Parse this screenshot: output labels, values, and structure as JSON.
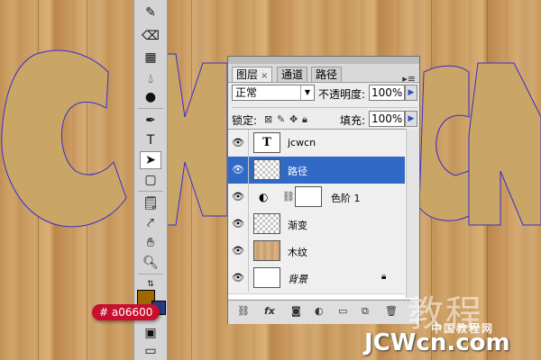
{
  "canvas": {
    "background": "#d4a86c"
  },
  "color_tag": {
    "label": "# a06600",
    "color": "#a06600"
  },
  "panel": {
    "tabs": [
      {
        "label": "图层",
        "close": "×"
      },
      {
        "label": "通道"
      },
      {
        "label": "路径"
      }
    ],
    "menu_icon": "panel-menu-icon",
    "blend_mode": "正常",
    "opacity_label": "不透明度:",
    "opacity_value": "100%",
    "lock_label": "锁定:",
    "fill_label": "填充:",
    "fill_value": "100%",
    "layers": [
      {
        "name": "jcwcn",
        "thumb": "T",
        "kind": "type"
      },
      {
        "name": "路径",
        "kind": "transparent",
        "selected": true
      },
      {
        "name": "色阶 1",
        "kind": "adjustment"
      },
      {
        "name": "渐变",
        "kind": "transparent"
      },
      {
        "name": "木纹",
        "kind": "wood"
      },
      {
        "name": "背景",
        "kind": "background"
      }
    ],
    "bottom_icons": [
      "link-layers-icon",
      "fx",
      "add-mask-icon",
      "adjustment-icon",
      "group-icon",
      "new-layer-icon",
      "delete-icon"
    ],
    "fx_label": "fx"
  },
  "toolbar": {
    "tools": [
      "healing-icon",
      "eraser-icon",
      "gradient-icon",
      "blur-icon",
      "dodge-icon",
      "pen-icon",
      "type-icon",
      "path-select-icon",
      "shape-icon",
      "notes-icon",
      "eyedropper-icon",
      "hand-icon",
      "zoom-icon"
    ],
    "type_glyph": "T"
  },
  "accent": {
    "selected": "#3169c6",
    "path_stroke": "#3a2bd0"
  },
  "watermark": {
    "big": "教程",
    "cn": "中国教程网",
    "url": "JCWcn.com"
  }
}
